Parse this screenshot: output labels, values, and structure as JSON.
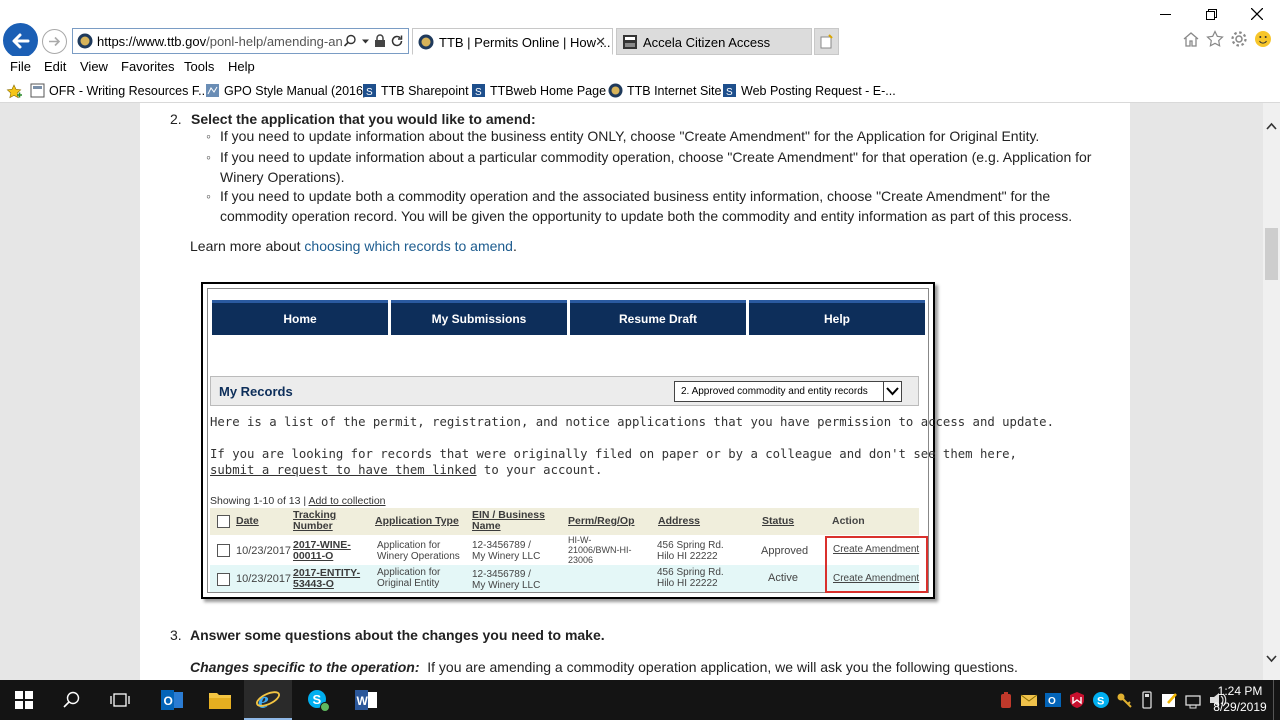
{
  "browser": {
    "url_main": "https://www.ttb.gov",
    "url_rest": "/ponl-help/amending-an",
    "tabs": [
      {
        "label": "TTB | Permits Online | How ...",
        "close": "✕"
      },
      {
        "label": "Accela Citizen Access"
      }
    ],
    "window_controls": [
      "minimize",
      "maximize",
      "close"
    ]
  },
  "menu": [
    "File",
    "Edit",
    "View",
    "Favorites",
    "Tools",
    "Help"
  ],
  "favorites": [
    "OFR - Writing Resources F...",
    "GPO Style Manual (2016)",
    "TTB Sharepoint",
    "TTBweb Home Page",
    "TTB Internet Site",
    "Web Posting Request - E-..."
  ],
  "page": {
    "step2": {
      "number": "2.",
      "heading": "Select the application that you would like to amend:",
      "bullets": [
        "If you need to update information about the business entity ONLY, choose \"Create Amendment\" for the Application for Original Entity.",
        "If you need to update information about a particular commodity operation, choose \"Create Amendment\" for that operation (e.g. Application for Winery Operations).",
        "If you need to update both a commodity operation and the associated business entity information, choose \"Create Amendment\" for the commodity operation record.  You will be given the opportunity to update both the commodity and entity information as part of this process."
      ],
      "learn_prefix": "Learn more about ",
      "learn_link": "choosing which records to amend",
      "learn_suffix": "."
    },
    "step3": {
      "number": "3.",
      "heading": "Answer some questions about the changes you need to make.",
      "sub_label": "Changes specific to the operation:",
      "sub_text": "If you are amending a commodity operation application, we will ask you the following questions."
    }
  },
  "embedded": {
    "nav": [
      "Home",
      "My Submissions",
      "Resume Draft",
      "Help"
    ],
    "records_title": "My Records",
    "records_select": "2. Approved commodity and entity records",
    "intro": "Here is a list of the permit, registration, and notice applications that you have permission to access and update.",
    "paper_line1": "If you are looking for records that were originally filed on paper or by a colleague and don't see them here,",
    "paper_link": "submit a request to have them linked",
    "paper_suffix": " to your account.",
    "showing": "Showing 1-10 of 13 | ",
    "add_collection": "Add to collection",
    "headers": {
      "date": "Date",
      "tracking_1": "Tracking",
      "tracking_2": "Number",
      "app_type": "Application Type",
      "ein_1": "EIN / Business",
      "ein_2": "Name",
      "permit": "Perm/Reg/Op",
      "address": "Address",
      "status": "Status",
      "action": "Action"
    },
    "rows": [
      {
        "date": "10/23/2017",
        "tracking_1": "2017-WINE-",
        "tracking_2": "00011-O",
        "app_1": "Application for",
        "app_2": "Winery Operations",
        "ein_1": "12-3456789 /",
        "ein_2": "My Winery LLC",
        "permit_1": "HI-W-",
        "permit_2": "21006/BWN-HI-",
        "permit_3": "23006",
        "addr_1": "456 Spring Rd.",
        "addr_2": "Hilo HI 22222",
        "status": "Approved",
        "action": "Create Amendment"
      },
      {
        "date": "10/23/2017",
        "tracking_1": "2017-ENTITY-",
        "tracking_2": "53443-O",
        "app_1": "Application for",
        "app_2": "Original Entity",
        "ein_1": "12-3456789 /",
        "ein_2": "My Winery LLC",
        "addr_1": "456 Spring Rd.",
        "addr_2": "Hilo HI 22222",
        "status": "Active",
        "action": "Create Amendment"
      }
    ]
  },
  "taskbar": {
    "time": "1:24 PM",
    "date": "8/29/2019"
  },
  "colors": {
    "accent_blue": "#0d2e5a",
    "link_blue": "#1d5c8f",
    "highlight_red": "#d9302c",
    "taskbar": "#141414"
  }
}
